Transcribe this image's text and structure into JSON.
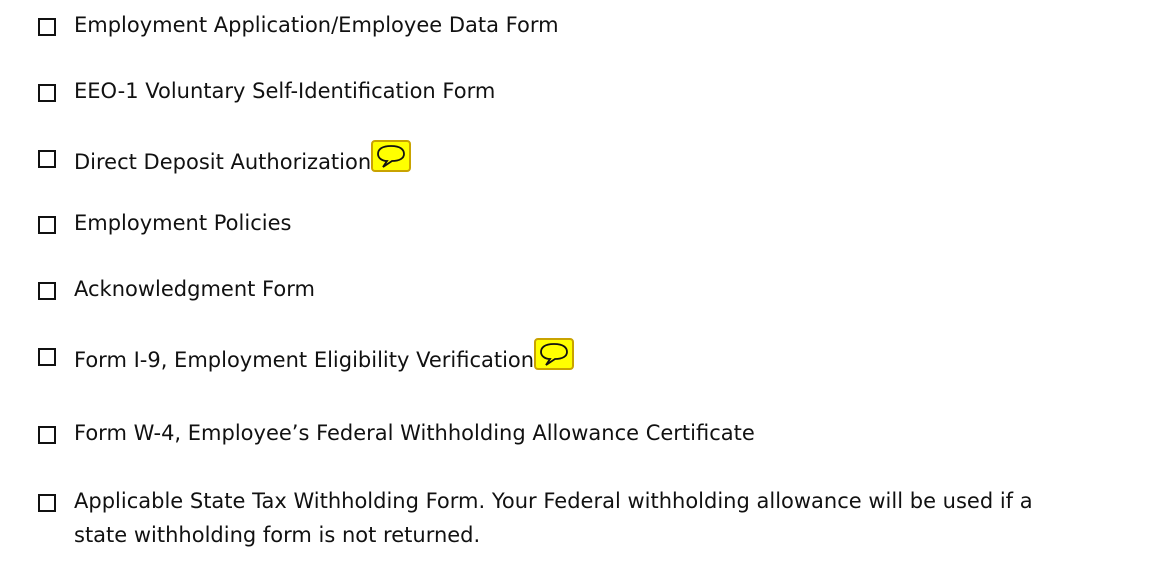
{
  "checklist": {
    "items": [
      {
        "label": "Employment Application/Employee Data Form"
      },
      {
        "label": "EEO-1 Voluntary Self-Identification Form"
      },
      {
        "label": "Direct Deposit Authorization",
        "comment_icon": "comment-note-icon"
      },
      {
        "label": "Employment Policies"
      },
      {
        "label": "Acknowledgment Form"
      },
      {
        "label": "Form I-9, Employment Eligibility Verification",
        "comment_icon": "comment-note-icon"
      },
      {
        "label": "Form W-4, Employee’s Federal Withholding Allowance Certificate"
      },
      {
        "label": "Applicable State Tax Withholding Form. Your Federal withholding allowance will be used if a state withholding form is not returned."
      }
    ]
  },
  "colors": {
    "text": "#111111",
    "comment_fill": "#ffff00",
    "comment_border": "#c9a300"
  }
}
